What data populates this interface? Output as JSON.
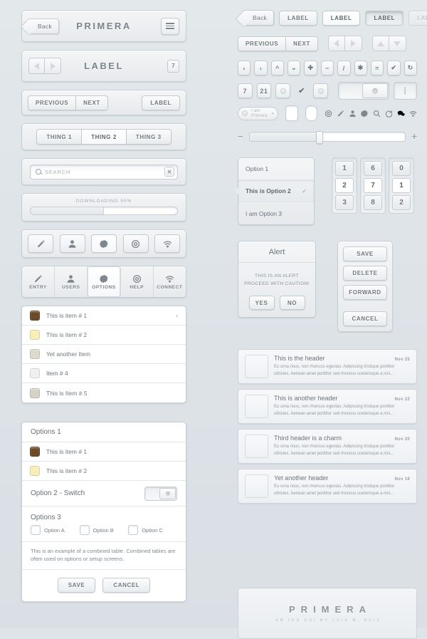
{
  "left": {
    "navbar": {
      "back": "Back",
      "title": "PRIMERA",
      "menu_icon": "hamburger-icon"
    },
    "labelbar": {
      "title": "LABEL",
      "badge": "7"
    },
    "toolbar": {
      "previous": "PREVIOUS",
      "next": "NEXT",
      "label": "LABEL"
    },
    "segmented": {
      "items": [
        "THING 1",
        "THING 2",
        "THING 3"
      ],
      "selected_index": 1
    },
    "search": {
      "placeholder": "SEARCH",
      "icon": "search-icon",
      "clear": "✕"
    },
    "progress": {
      "label": "DOWNLOADING 50%",
      "percent": 50
    },
    "icon_toolbar": [
      {
        "name": "pencil-icon",
        "active": false
      },
      {
        "name": "user-icon",
        "active": false
      },
      {
        "name": "gear-icon",
        "active": true
      },
      {
        "name": "lifering-icon",
        "active": false
      },
      {
        "name": "wifi-icon",
        "active": false
      }
    ],
    "tabbar": [
      {
        "label": "ENTRY",
        "icon": "pencil-icon",
        "selected": false
      },
      {
        "label": "USERS",
        "icon": "user-icon",
        "selected": false
      },
      {
        "label": "OPTIONS",
        "icon": "gear-icon",
        "selected": true
      },
      {
        "label": "HELP",
        "icon": "lifering-icon",
        "selected": false
      },
      {
        "label": "CONNECT",
        "icon": "wifi-icon",
        "selected": false
      }
    ],
    "list": [
      {
        "label": "This is item # 1",
        "color": "#6b4a2a",
        "chevron": "›"
      },
      {
        "label": "This is item # 2",
        "color": "#f7efb5",
        "chevron": ""
      },
      {
        "label": "Yet another Item",
        "color": "#ddd9cd",
        "chevron": ""
      },
      {
        "label": "Item # 4",
        "color": "#eef0f2",
        "chevron": ""
      },
      {
        "label": "This is Item # 5",
        "color": "#d6d2c6",
        "chevron": ""
      }
    ],
    "options_card": {
      "group1_title": "Options 1",
      "group1_items": [
        {
          "label": "This is item # 1",
          "color": "#6b4a2a"
        },
        {
          "label": "This is item # 2",
          "color": "#f7efb5"
        }
      ],
      "switch_label": "Option 2 - Switch",
      "group3_title": "Options 3",
      "checkboxes": [
        "Option A",
        "Option B",
        "Option C"
      ],
      "note": "This is an example of a combined table. Combined tables are often used on options or setup screens.",
      "save": "SAVE",
      "cancel": "CANCEL"
    }
  },
  "right": {
    "nav_buttons": [
      {
        "label": "Back",
        "style": "back"
      },
      {
        "label": "LABEL",
        "style": "normal"
      },
      {
        "label": "LABEL",
        "style": "active"
      },
      {
        "label": "LABEL",
        "style": "pressed"
      },
      {
        "label": "LABEL",
        "style": "disabled"
      }
    ],
    "prevnext": {
      "previous": "PREVIOUS",
      "next": "NEXT"
    },
    "arrow_groups": [
      [
        "triangle-left-icon",
        "triangle-right-icon"
      ],
      [
        "triangle-up-icon",
        "triangle-down-icon"
      ]
    ],
    "mini_buttons": [
      "chevron-left-icon",
      "chevron-right-icon",
      "chevron-up-icon",
      "chevron-down-icon",
      "plus-icon",
      "minus-icon",
      "slash-icon",
      "asterisk-icon",
      "equals-icon",
      "check-icon",
      "refresh-icon"
    ],
    "badges": [
      "7",
      "21"
    ],
    "badge_dot_icon": "dot-badge-icon",
    "check_badge_icon": "check-badge-icon",
    "dot_badge_icon2": "dot-badge-icon",
    "pill": {
      "label": "I am Primera",
      "chevron": "›"
    },
    "checkbox_icons": [
      "square-checkbox-icon",
      "rounded-checkbox-icon"
    ],
    "icon_strip": [
      "lifering-icon",
      "pencil-icon",
      "user-icon",
      "gear-icon",
      "search-icon",
      "refresh-icon",
      "chat-icon",
      "wifi-icon"
    ],
    "slider": {
      "minus": "−",
      "plus": "+",
      "value": 45
    },
    "options": [
      {
        "label": "Option 1",
        "selected": false,
        "tick": ""
      },
      {
        "label": "This is Option 2",
        "selected": true,
        "tick": "✓"
      },
      {
        "label": "I am Option 3",
        "selected": false,
        "tick": ""
      }
    ],
    "keypad": [
      {
        "keys": [
          "1",
          "2",
          "3"
        ],
        "highlight_index": 1
      },
      {
        "keys": [
          "6",
          "7",
          "8"
        ],
        "highlight_index": 1
      },
      {
        "keys": [
          "0",
          "1",
          "2"
        ],
        "highlight_index": 1
      }
    ],
    "alert": {
      "title": "Alert",
      "line1": "THIS IS AN ALERT",
      "line2": "PROCEED WITH CAUTION!",
      "yes": "YES",
      "no": "NO"
    },
    "action_buttons": [
      "SAVE",
      "DELETE",
      "FORWARD",
      "CANCEL"
    ],
    "messages": [
      {
        "header": "This is the header",
        "date": "Nov 25",
        "body": "Eu urna risus, non rhoncus egestas. Adipiscing tristique porttitor ultricies. Aenean amet porttitor sed rhoncus scelerisque a nisi..."
      },
      {
        "header": "This is another header",
        "date": "Nov 22",
        "body": "Eu urna risus, non rhoncus egestas. Adipiscing tristique porttitor ultricies. Aenean amet porttitor sed rhoncus scelerisque a nisi..."
      },
      {
        "header": "Third header is a charm",
        "date": "Nov 20",
        "body": "Eu urna risus, non rhoncus egestas. Adipiscing tristique porttitor ultricies. Aenean amet porttitor sed rhoncus scelerisque a nisi..."
      },
      {
        "header": "Yet another header",
        "date": "Nov 18",
        "body": "Eu urna risus, non rhoncus egestas. Adipiscing tristique porttitor ultricies. Aenean amet porttitor sed rhoncus scelerisque a nisi..."
      }
    ],
    "footer": {
      "title": "PRIMERA",
      "subtitle": "AN IOS GUI BY LUIS M. RUIZ"
    }
  }
}
